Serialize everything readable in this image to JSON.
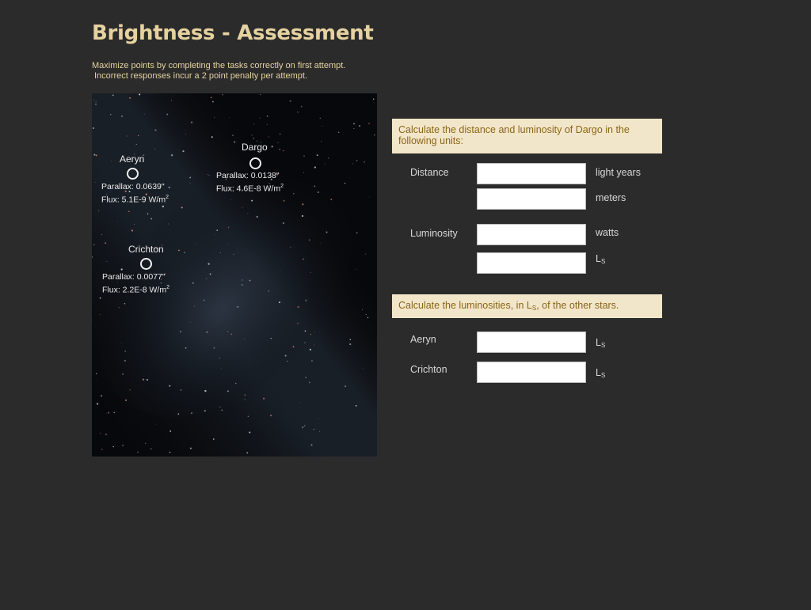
{
  "header": {
    "title": "Brightness - Assessment",
    "instructions_line1": "Maximize points by completing the tasks correctly on first attempt.",
    "instructions_line2": "Incorrect responses incur a 2 point penalty per attempt."
  },
  "stars": {
    "aeryn": {
      "name": "Aeryn",
      "parallax": "Parallax:  0.0639\"",
      "flux_prefix": "Flux:  5.1E-9 W/m",
      "flux_exp": "2"
    },
    "dargo": {
      "name": "Dargo",
      "parallax": "Parallax:  0.0138\"",
      "flux_prefix": "Flux:  4.6E-8 W/m",
      "flux_exp": "2"
    },
    "crichton": {
      "name": "Crichton",
      "parallax": "Parallax:  0.0077\"",
      "flux_prefix": "Flux:  2.2E-8 W/m",
      "flux_exp": "2"
    }
  },
  "task1": {
    "header": "Calculate the distance and luminosity of Dargo in the following units:",
    "distance_label": "Distance",
    "luminosity_label": "Luminosity",
    "units": {
      "light_years": "light years",
      "meters": "meters",
      "watts": "watts",
      "solar_L": "L",
      "solar_sub": "S"
    },
    "values": {
      "distance_ly": "",
      "distance_m": "",
      "lum_watts": "",
      "lum_solar": ""
    }
  },
  "task2": {
    "header_prefix": "Calculate the luminosities, in L",
    "header_sub": "S",
    "header_suffix": ", of the other stars.",
    "aeryn_label": "Aeryn",
    "crichton_label": "Crichton",
    "unit_L": "L",
    "unit_sub": "S",
    "values": {
      "aeryn": "",
      "crichton": ""
    }
  },
  "colors": {
    "background": "#2b2b2b",
    "title": "#e6d2a0",
    "panel_header_bg": "#f2e6ca",
    "panel_header_text": "#8a6518"
  }
}
